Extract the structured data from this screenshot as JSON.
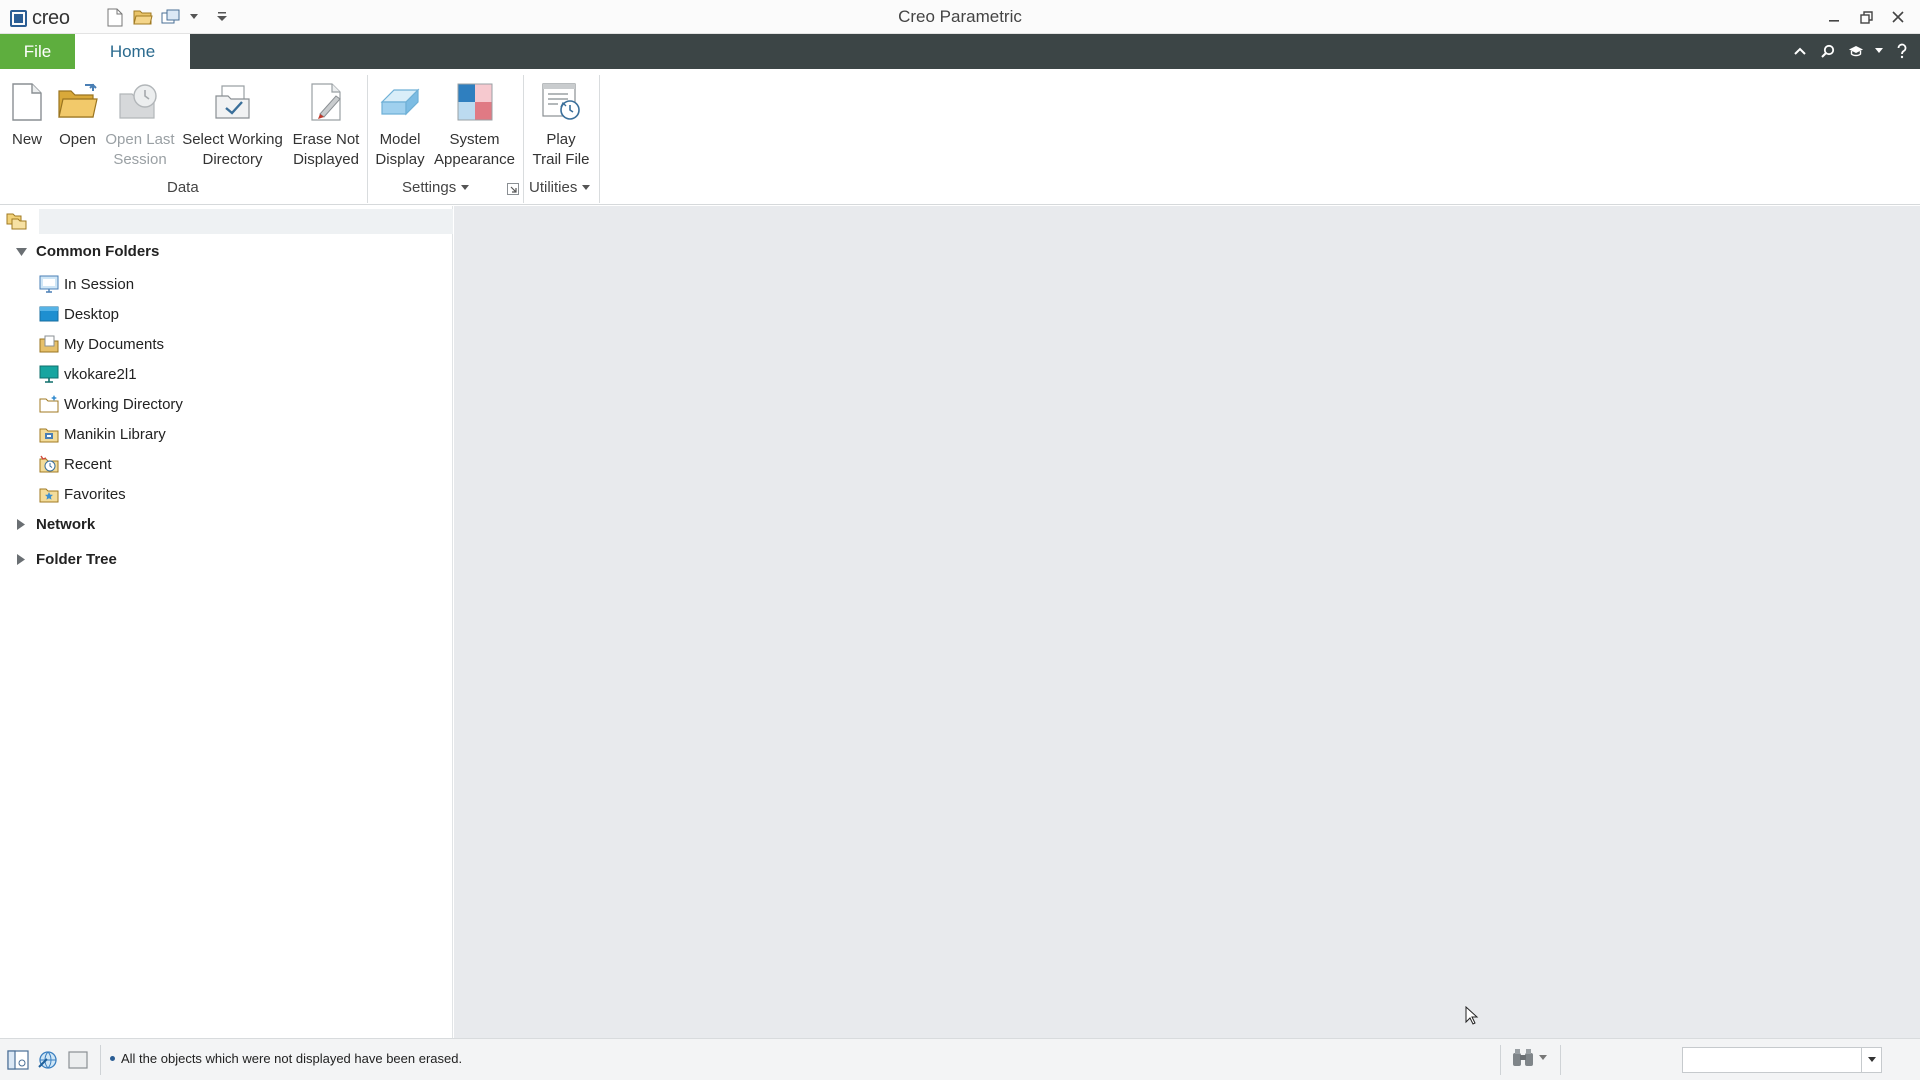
{
  "window": {
    "app_title": "Creo Parametric",
    "logo_text": "creo"
  },
  "ribbon_tabs": {
    "file": "File",
    "home": "Home"
  },
  "ribbon": {
    "buttons": {
      "new": [
        "New"
      ],
      "open": [
        "Open"
      ],
      "open_last_session": [
        "Open Last",
        "Session"
      ],
      "select_working_directory": [
        "Select Working",
        "Directory"
      ],
      "erase_not_displayed": [
        "Erase Not",
        "Displayed"
      ],
      "model_display": [
        "Model",
        "Display"
      ],
      "system_appearance": [
        "System",
        "Appearance"
      ],
      "play_trail_file": [
        "Play",
        "Trail File"
      ]
    },
    "groups": {
      "data": "Data",
      "settings": "Settings",
      "utilities": "Utilities"
    }
  },
  "navigator": {
    "common_folders": {
      "label": "Common Folders",
      "expanded": true,
      "items": [
        {
          "label": "In Session",
          "icon": "monitor-session-icon"
        },
        {
          "label": "Desktop",
          "icon": "desktop-icon"
        },
        {
          "label": "My Documents",
          "icon": "documents-icon"
        },
        {
          "label": "vkokare2l1",
          "icon": "computer-icon"
        },
        {
          "label": "Working Directory",
          "icon": "working-directory-icon"
        },
        {
          "label": "Manikin Library",
          "icon": "manikin-library-icon"
        },
        {
          "label": "Recent",
          "icon": "recent-icon"
        },
        {
          "label": "Favorites",
          "icon": "favorites-icon"
        }
      ]
    },
    "network": {
      "label": "Network",
      "expanded": false
    },
    "folder_tree": {
      "label": "Folder Tree",
      "expanded": false
    }
  },
  "status": {
    "message": "All the objects which were not displayed have been erased.",
    "selection_filter_value": ""
  },
  "colors": {
    "file_tab": "#5eae3e",
    "tab_bar": "#3c4546",
    "home_tab_text": "#2a6a8e",
    "main_background": "#e8eaed"
  }
}
